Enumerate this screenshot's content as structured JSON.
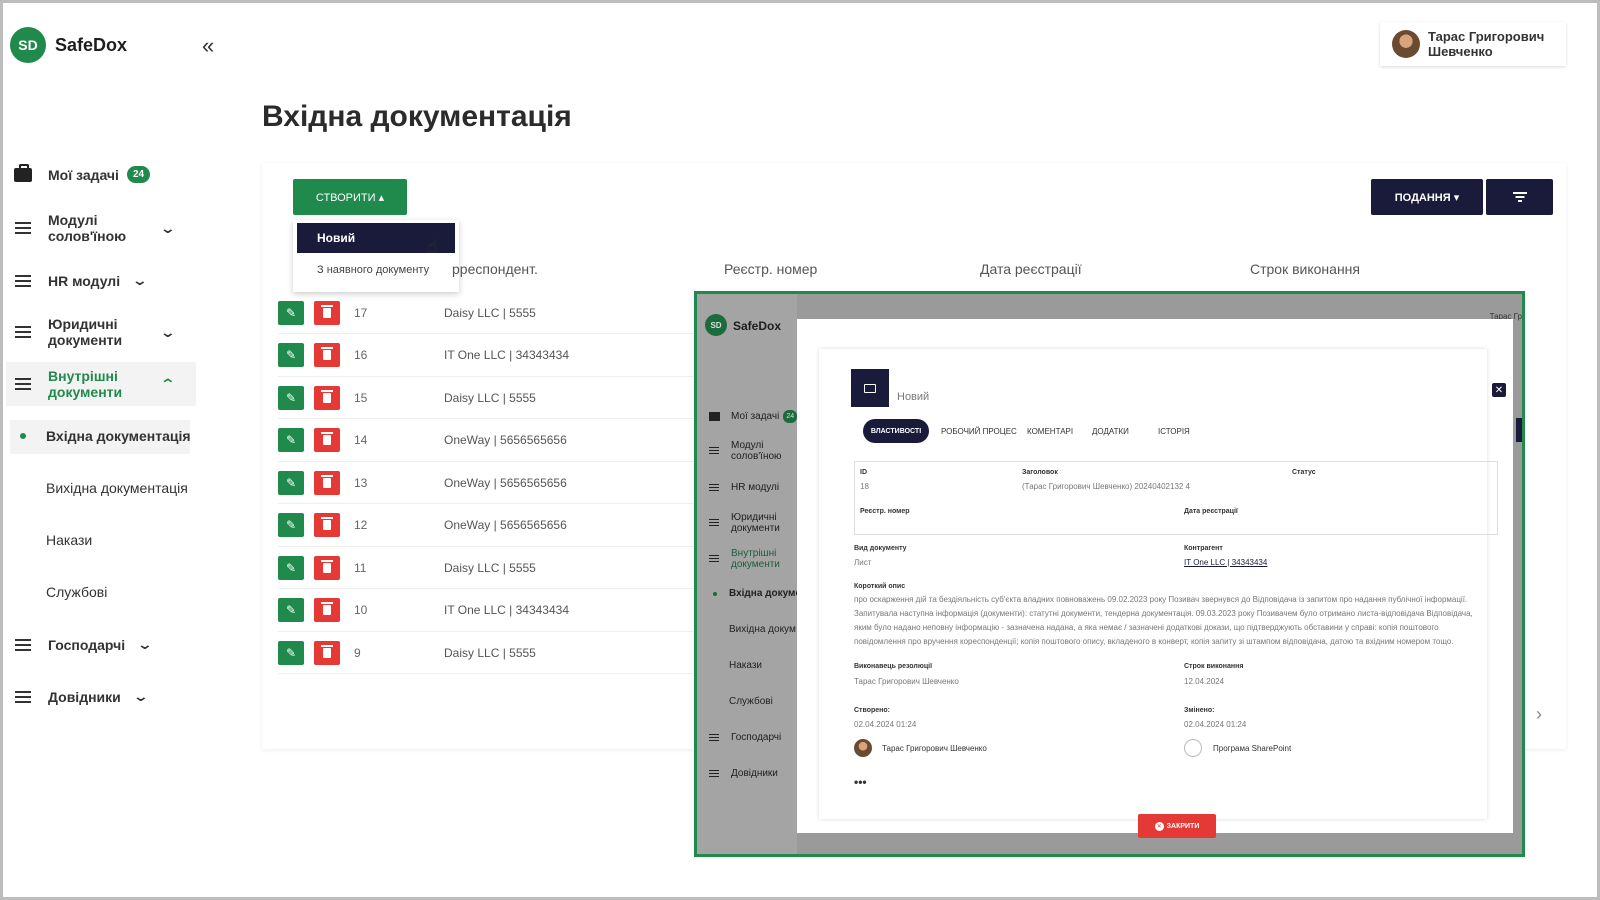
{
  "app": {
    "logo_initials": "SD",
    "logo_name": "SafeDox",
    "collapse_glyph": "«"
  },
  "user": {
    "name_line1": "Тарас Григорович",
    "name_line2": "Шевченко"
  },
  "page_title": "Вхідна документація",
  "sidebar": {
    "items": [
      {
        "label": "Мої задачі",
        "badge": "24",
        "icon": "briefcase-icon"
      },
      {
        "label_line1": "Модулі",
        "label_line2": "солов'їною",
        "icon": "list-icon",
        "chevron": "⌄"
      },
      {
        "label": "HR модулі",
        "icon": "list-icon",
        "chevron": "⌄"
      },
      {
        "label_line1": "Юридичні",
        "label_line2": "документи",
        "icon": "list-icon",
        "chevron": "⌄"
      },
      {
        "label_line1": "Внутрішні",
        "label_line2": "документи",
        "icon": "list-icon",
        "chevron": "⌃",
        "active": true
      },
      {
        "label": "Господарчі",
        "icon": "list-icon",
        "chevron": "⌄"
      },
      {
        "label": "Довідники",
        "icon": "list-icon",
        "chevron": "⌄"
      }
    ],
    "sub_items": [
      "Вхідна документація",
      "Вихідна документація",
      "Накази",
      "Службові"
    ]
  },
  "toolbar": {
    "create_label": "СТВОРИТИ ▴",
    "view_label": "ПОДАННЯ ▾",
    "menu_new": "Новий",
    "menu_existing": "З наявного документу"
  },
  "table": {
    "headers": {
      "correspondent": "рреспондент.",
      "reg_number": "Реєстр. номер",
      "reg_date": "Дата реєстрації",
      "deadline": "Строк виконання"
    },
    "rows": [
      {
        "id": "17",
        "correspondent": "Daisy LLC | 5555"
      },
      {
        "id": "16",
        "correspondent": "IT One LLC | 34343434"
      },
      {
        "id": "15",
        "correspondent": "Daisy LLC | 5555"
      },
      {
        "id": "14",
        "correspondent": "OneWay | 5656565656"
      },
      {
        "id": "13",
        "correspondent": "OneWay | 5656565656"
      },
      {
        "id": "12",
        "correspondent": "OneWay | 5656565656"
      },
      {
        "id": "11",
        "correspondent": "Daisy LLC | 5555"
      },
      {
        "id": "10",
        "correspondent": "IT One LLC | 34343434"
      },
      {
        "id": "9",
        "correspondent": "Daisy LLC | 5555"
      }
    ]
  },
  "overlay": {
    "logo_initials": "SD",
    "logo_name": "SafeDox",
    "user_short": "Тарас Гр",
    "nav": {
      "tasks": "Мої задачі",
      "tasks_badge": "24",
      "modules_l1": "Модулі",
      "modules_l2": "солов'їною",
      "hr": "HR модулі",
      "legal_l1": "Юридичні",
      "legal_l2": "документи",
      "internal_l1": "Внутрішні",
      "internal_l2": "документи",
      "incoming": "Вхідна докуме",
      "outgoing": "Вихідна докум",
      "orders": "Накази",
      "service": "Службові",
      "econ": "Господарчі",
      "refs": "Довідники"
    },
    "modal": {
      "title": "Новий",
      "tabs": [
        "ВЛАСТИВОСТІ",
        "РОБОЧИЙ ПРОЦЕС",
        "КОМЕНТАРІ",
        "ДОДАТКИ",
        "ІСТОРІЯ"
      ],
      "id_label": "ID",
      "id_value": "18",
      "heading_label": "Заголовок",
      "heading_value": "(Тарас Григорович Шевченко) 20240402132 4",
      "status_label": "Статус",
      "reg_num_label": "Реєстр. номер",
      "reg_date_label": "Дата реєстрації",
      "doc_type_label": "Вид документу",
      "doc_type_value": "Лист",
      "counterparty_label": "Контрагент",
      "counterparty_value": "IT One LLC | 34343434",
      "desc_label": "Короткий опис",
      "desc_value": "про оскарження дій та бездіяльність суб'єкта владних повноважень 09.02.2023 року Позивач звернувся до Відповідача із запитом про надання публічної інформації. Запитувала наступна інформація (документи): статутні документи, тендерна документація. 09.03.2023 року Позивачем було отримано листа-відповідача Відповідача, яким було надано неповну інформацію - зазначена надана, а яка немає / зазначені додаткові докази, що підтверджують обставини у справі: копія поштового повідомлення про вручення кореспонденції; копія поштового опису, вкладеного в конверт, копія запиту зі штампом відповідача, датою та вхідним номером тощо.",
      "executor_label": "Виконавець резолюції",
      "executor_value": "Тарас Григорович Шевченко",
      "deadline_label": "Строк виконання",
      "deadline_value": "12.04.2024",
      "created_label": "Створено:",
      "created_value": "02.04.2024 01:24",
      "modified_label": "Змінено:",
      "modified_value": "02.04.2024 01:24",
      "creator": "Тарас Григорович Шевченко",
      "modifier": "Програма SharePoint",
      "more": "•••",
      "close_button": "ЗАКРИТИ"
    }
  }
}
